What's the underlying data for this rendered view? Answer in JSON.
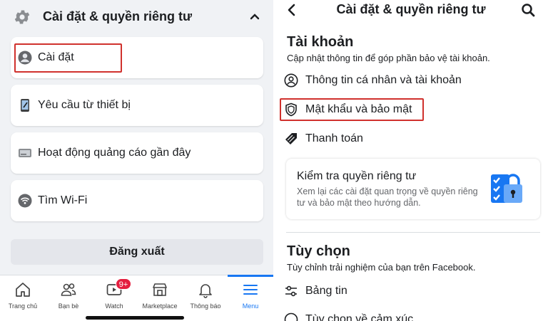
{
  "left": {
    "section_title": "Cài đặt & quyền riêng tư",
    "items": [
      {
        "label": "Cài đặt",
        "icon": "user-circle-icon"
      },
      {
        "label": "Yêu cầu từ thiết bị",
        "icon": "phone-icon"
      },
      {
        "label": "Hoạt động quảng cáo gần đây",
        "icon": "ad-card-icon"
      },
      {
        "label": "Tìm Wi-Fi",
        "icon": "wifi-icon"
      }
    ],
    "logout_label": "Đăng xuất",
    "tabs": [
      {
        "label": "Trang chủ",
        "icon": "home-icon"
      },
      {
        "label": "Bạn bè",
        "icon": "friends-icon"
      },
      {
        "label": "Watch",
        "icon": "watch-icon",
        "badge": "9+"
      },
      {
        "label": "Marketplace",
        "icon": "marketplace-icon"
      },
      {
        "label": "Thông báo",
        "icon": "bell-icon"
      },
      {
        "label": "Menu",
        "icon": "menu-icon",
        "active": true
      }
    ]
  },
  "right": {
    "title": "Cài đặt & quyền riêng tư",
    "account": {
      "heading": "Tài khoản",
      "subheading": "Cập nhật thông tin để góp phần bảo vệ tài khoản.",
      "items": [
        {
          "label": "Thông tin cá nhân và tài khoản",
          "icon": "person-circle-icon"
        },
        {
          "label": "Mật khẩu và bảo mật",
          "icon": "shield-icon"
        },
        {
          "label": "Thanh toán",
          "icon": "tag-icon"
        }
      ]
    },
    "privacy_check": {
      "title": "Kiểm tra quyền riêng tư",
      "description": "Xem lại các cài đặt quan trọng về quyền riêng tư và bảo mật theo hướng dẫn."
    },
    "preferences": {
      "heading": "Tùy chọn",
      "subheading": "Tùy chỉnh trải nghiệm của bạn trên Facebook.",
      "items": [
        {
          "label": "Bảng tin",
          "icon": "sliders-icon"
        },
        {
          "label": "Tùy chọn về cảm xúc",
          "icon": "emoji-icon"
        }
      ]
    }
  },
  "colors": {
    "accent": "#1877f2",
    "highlight": "#d0312d",
    "badge": "#e41e3f"
  }
}
